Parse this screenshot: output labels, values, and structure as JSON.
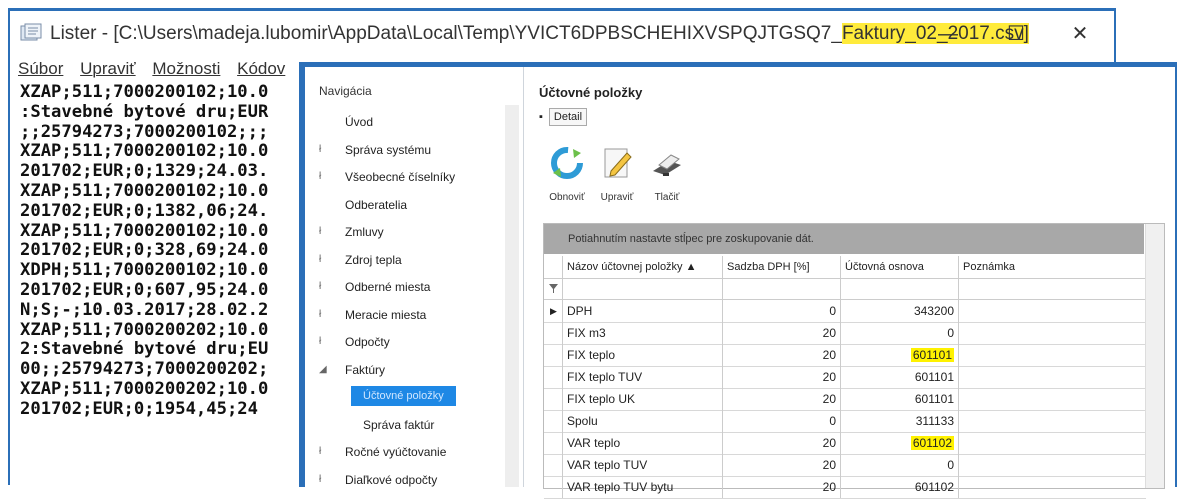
{
  "lister": {
    "title_prefix": "Lister - [C:\\Users\\madeja.lubomir\\AppData\\Local\\Temp\\YVICT6DPBSCHEHIXVSPQJTGSQ7_",
    "title_highlight": "Faktury_02_2017.csv]",
    "minimize": "—",
    "maximize": "☐",
    "close": "✕",
    "menu": [
      "Súbor",
      "Upraviť",
      "Možnosti",
      "Kódov"
    ],
    "lines": [
      "XZAP;511;7000200102;10.0",
      ":Stavebné bytové dru;EUR",
      ";;25794273;7000200102;;;",
      "XZAP;511;7000200102;10.0",
      "201702;EUR;0;1329;24.03.",
      "XZAP;511;7000200102;10.0",
      "201702;EUR;0;1382,06;24.",
      "XZAP;511;7000200102;10.0",
      "201702;EUR;0;328,69;24.0",
      "XDPH;511;7000200102;10.0",
      "201702;EUR;0;607,95;24.0",
      "N;S;-;10.03.2017;28.02.2",
      "XZAP;511;7000200202;10.0",
      "2:Stavebné bytové dru;EU",
      "00;;25794273;7000200202;",
      "XZAP;511;7000200202;10.0",
      "201702;EUR;0;1954,45;24"
    ]
  },
  "nav": {
    "header": "Navigácia",
    "items": [
      {
        "label": "Úvod",
        "glyph": ""
      },
      {
        "label": "Správa systému",
        "glyph": "ł"
      },
      {
        "label": "Všeobecné číselníky",
        "glyph": "ł"
      },
      {
        "label": "Odberatelia",
        "glyph": ""
      },
      {
        "label": "Zmluvy",
        "glyph": "ł"
      },
      {
        "label": "Zdroj tepla",
        "glyph": "ł"
      },
      {
        "label": "Odberné miesta",
        "glyph": "ł"
      },
      {
        "label": "Meracie miesta",
        "glyph": "ł"
      },
      {
        "label": "Odpočty",
        "glyph": "ł"
      },
      {
        "label": "Faktúry",
        "glyph": "◢"
      },
      {
        "label": "Účtovné položky",
        "glyph": ""
      },
      {
        "label": "Správa faktúr",
        "glyph": ""
      },
      {
        "label": "Ročné vyúčtovanie",
        "glyph": "ł"
      },
      {
        "label": "Diaľkové odpočty",
        "glyph": "ł"
      }
    ]
  },
  "panel": {
    "title": "Účtovné položky",
    "detail_bullet": "▪",
    "detail_tab": "Detail",
    "toolbar": {
      "refresh": "Obnoviť",
      "edit": "Upraviť",
      "print": "Tlačiť"
    }
  },
  "grid": {
    "group_hint": "Potiahnutím nastavte stĺpec pre zoskupovanie dát.",
    "headers": [
      "Názov účtovnej položky ▲",
      "Sadzba DPH [%]",
      "Účtovná osnova",
      "Poznámka"
    ],
    "rows": [
      {
        "name": "DPH",
        "rate": "0",
        "account": "343200",
        "note": "",
        "current": true
      },
      {
        "name": "FIX m3",
        "rate": "20",
        "account": "0",
        "note": ""
      },
      {
        "name": "FIX teplo",
        "rate": "20",
        "account": "601101",
        "note": "",
        "highlight": true
      },
      {
        "name": "FIX teplo TUV",
        "rate": "20",
        "account": "601101",
        "note": ""
      },
      {
        "name": "FIX teplo UK",
        "rate": "20",
        "account": "601101",
        "note": ""
      },
      {
        "name": "Spolu",
        "rate": "0",
        "account": "311133",
        "note": ""
      },
      {
        "name": "VAR teplo",
        "rate": "20",
        "account": "601102",
        "note": "",
        "highlight": true
      },
      {
        "name": "VAR teplo TUV",
        "rate": "20",
        "account": "0",
        "note": ""
      },
      {
        "name": "VAR teplo TUV bytu",
        "rate": "20",
        "account": "601102",
        "note": ""
      }
    ]
  },
  "colors": {
    "window_border": "#2b6fb8",
    "highlight": "#fff200",
    "nav_active": "#1e88e5",
    "group_bar": "#a8a8a8"
  }
}
